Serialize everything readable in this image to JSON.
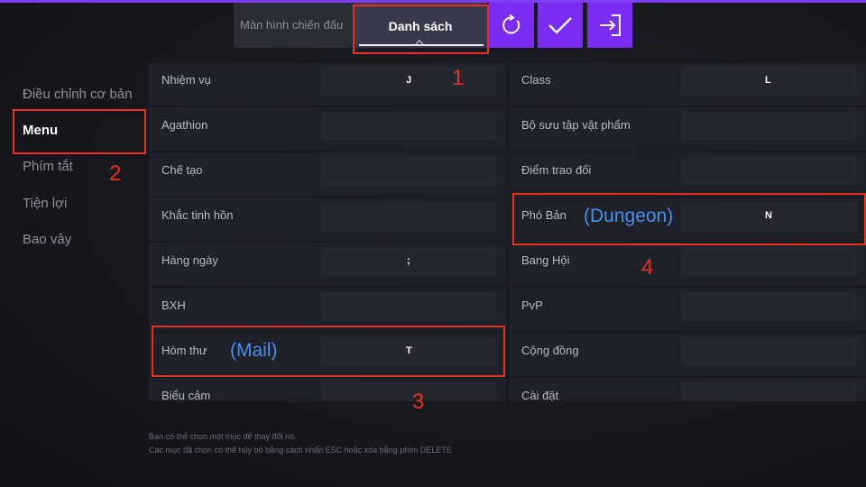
{
  "tabs": [
    {
      "label": "Màn hình chiến đấu"
    },
    {
      "label": "Danh sách"
    }
  ],
  "toolbar": {
    "reset_icon": "refresh-icon",
    "confirm_icon": "check-icon",
    "exit_icon": "exit-icon"
  },
  "sidebar": {
    "items": [
      {
        "label": "Điều chỉnh cơ bản"
      },
      {
        "label": "Menu"
      },
      {
        "label": "Phím tắt"
      },
      {
        "label": "Tiện lợi"
      },
      {
        "label": "Bao vây"
      }
    ]
  },
  "left_column": [
    {
      "label": "Nhiệm vụ",
      "key": "J"
    },
    {
      "label": "Agathion",
      "key": ""
    },
    {
      "label": "Chế tạo",
      "key": ""
    },
    {
      "label": "Khắc tinh hồn",
      "key": ""
    },
    {
      "label": "Hàng ngày",
      "key": ";"
    },
    {
      "label": "BXH",
      "key": ""
    },
    {
      "label": "Hòm thư",
      "key": "T"
    },
    {
      "label": "Biểu cảm",
      "key": ""
    }
  ],
  "right_column": [
    {
      "label": "Class",
      "key": "L"
    },
    {
      "label": "Bộ sưu tập vật phẩm",
      "key": ""
    },
    {
      "label": "Điểm trao đổi",
      "key": ""
    },
    {
      "label": "Phó Bản",
      "key": "N"
    },
    {
      "label": "Bang Hội",
      "key": ""
    },
    {
      "label": "PvP",
      "key": ""
    },
    {
      "label": "Cộng đồng",
      "key": ""
    },
    {
      "label": "Cài đặt",
      "key": ""
    }
  ],
  "footer": {
    "line1": "Bạn có thể chọn một mục để thay đổi nó.",
    "line2": "Các mục đã chọn có thể hủy bỏ bằng cách nhấn ESC hoặc xóa bằng phím DELETE"
  },
  "annotations": {
    "n1": "1",
    "n2": "2",
    "n3": "3",
    "n4": "4",
    "mail": "(Mail)",
    "dungeon": "(Dungeon)"
  },
  "colors": {
    "accent": "#7a2df0",
    "annotation": "#e8301b",
    "note": "#4a8ff0"
  }
}
